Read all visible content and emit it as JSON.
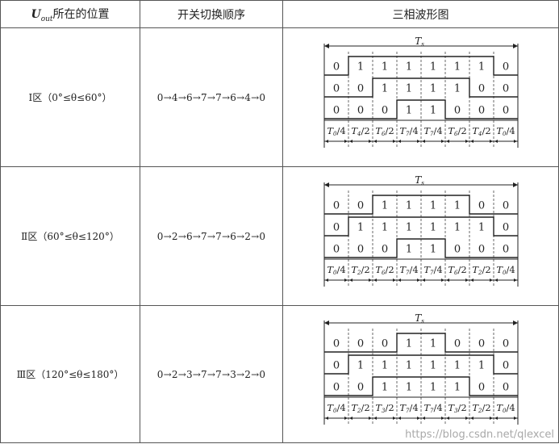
{
  "header": {
    "col1_var": "U",
    "col1_sub": "out",
    "col1_text": "所在的位置",
    "col2": "开关切换顺序",
    "col3": "三相波形图"
  },
  "period_label": "T",
  "period_sub": "s",
  "rows": [
    {
      "zone": "Ⅰ区（0°≤θ≤60°）",
      "sequence": "0→4→6→7→7→6→4→0",
      "phases": [
        [
          0,
          1,
          1,
          1,
          1,
          1,
          1,
          0
        ],
        [
          0,
          0,
          1,
          1,
          1,
          1,
          0,
          0
        ],
        [
          0,
          0,
          0,
          1,
          1,
          0,
          0,
          0
        ]
      ],
      "times": [
        [
          "0",
          "4"
        ],
        [
          "4",
          "2"
        ],
        [
          "6",
          "2"
        ],
        [
          "7",
          "4"
        ],
        [
          "7",
          "4"
        ],
        [
          "6",
          "2"
        ],
        [
          "4",
          "2"
        ],
        [
          "0",
          "4"
        ]
      ]
    },
    {
      "zone": "Ⅱ区（60°≤θ≤120°）",
      "sequence": "0→2→6→7→7→6→2→0",
      "phases": [
        [
          0,
          0,
          1,
          1,
          1,
          1,
          0,
          0
        ],
        [
          0,
          1,
          1,
          1,
          1,
          1,
          1,
          0
        ],
        [
          0,
          0,
          0,
          1,
          1,
          0,
          0,
          0
        ]
      ],
      "times": [
        [
          "0",
          "4"
        ],
        [
          "2",
          "2"
        ],
        [
          "6",
          "2"
        ],
        [
          "7",
          "4"
        ],
        [
          "7",
          "4"
        ],
        [
          "6",
          "2"
        ],
        [
          "2",
          "2"
        ],
        [
          "0",
          "4"
        ]
      ]
    },
    {
      "zone": "Ⅲ区（120°≤θ≤180°）",
      "sequence": "0→2→3→7→7→3→2→0",
      "phases": [
        [
          0,
          0,
          0,
          1,
          1,
          0,
          0,
          0
        ],
        [
          0,
          1,
          1,
          1,
          1,
          1,
          1,
          0
        ],
        [
          0,
          0,
          1,
          1,
          1,
          1,
          0,
          0
        ]
      ],
      "times": [
        [
          "0",
          "4"
        ],
        [
          "2",
          "2"
        ],
        [
          "3",
          "2"
        ],
        [
          "7",
          "4"
        ],
        [
          "7",
          "4"
        ],
        [
          "3",
          "2"
        ],
        [
          "2",
          "2"
        ],
        [
          "0",
          "4"
        ]
      ]
    }
  ],
  "watermark": "https://blog.csdn.net/qlexcel"
}
